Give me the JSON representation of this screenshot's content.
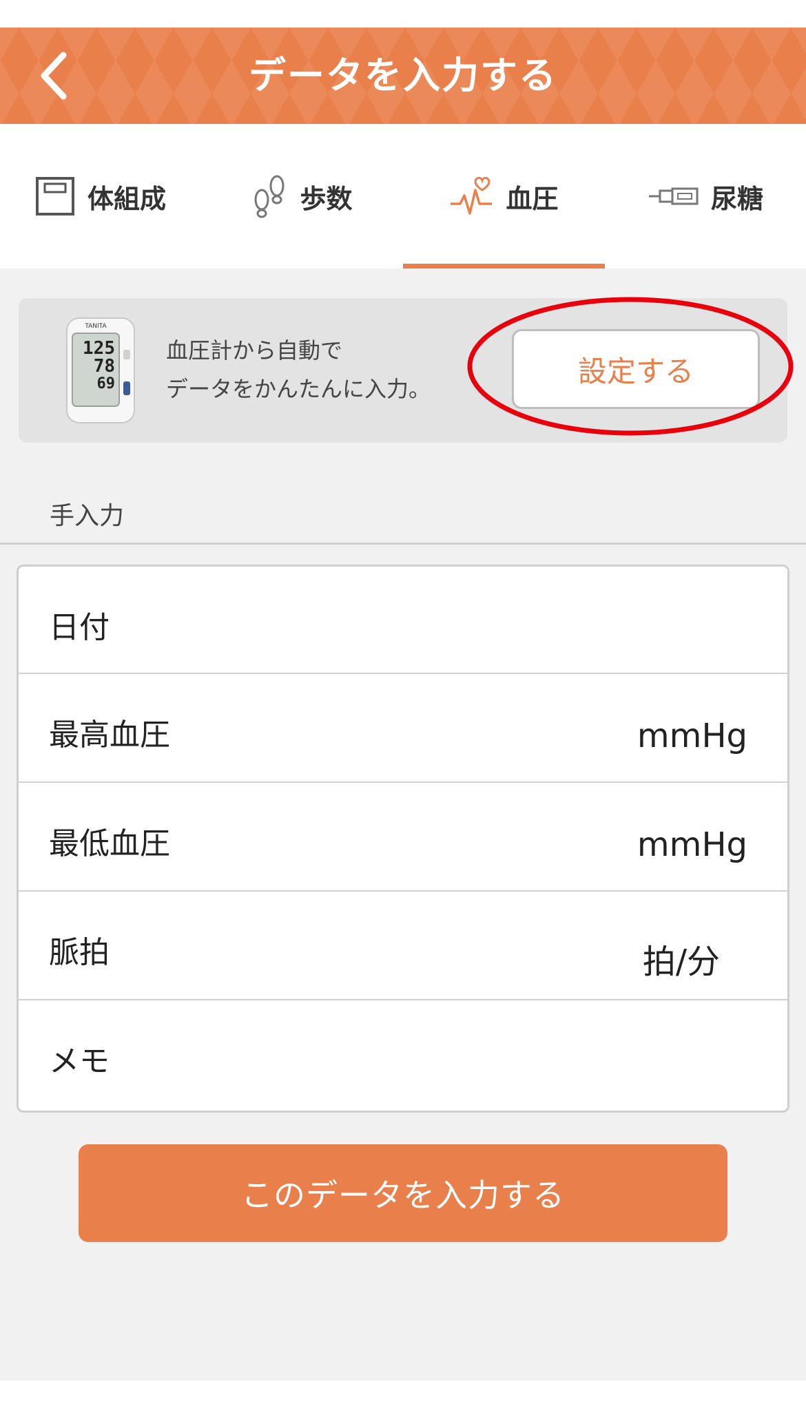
{
  "header": {
    "title": "データを入力する",
    "back_icon": "chevron-left-icon"
  },
  "tabs": [
    {
      "label": "体組成",
      "icon": "scale-icon",
      "active": false
    },
    {
      "label": "歩数",
      "icon": "footprints-icon",
      "active": false
    },
    {
      "label": "血圧",
      "icon": "heartbeat-icon",
      "active": true
    },
    {
      "label": "尿糖",
      "icon": "urine-test-strip-icon",
      "active": false
    }
  ],
  "promo": {
    "line1": "血圧計から自動で",
    "line2": "データをかんたんに入力。",
    "button_label": "設定する",
    "device_brand": "TANITA",
    "device_readings": [
      "125",
      "78",
      "69"
    ]
  },
  "manual_entry": {
    "section_label": "手入力",
    "rows": [
      {
        "label": "日付",
        "unit": ""
      },
      {
        "label": "最高血圧",
        "unit": "mmHg"
      },
      {
        "label": "最低血圧",
        "unit": "mmHg"
      },
      {
        "label": "脈拍",
        "unit": "拍/分"
      },
      {
        "label": "メモ",
        "unit": ""
      }
    ],
    "submit_label": "このデータを入力する"
  },
  "colors": {
    "accent": "#e9804c",
    "highlight": "#e8000b"
  }
}
